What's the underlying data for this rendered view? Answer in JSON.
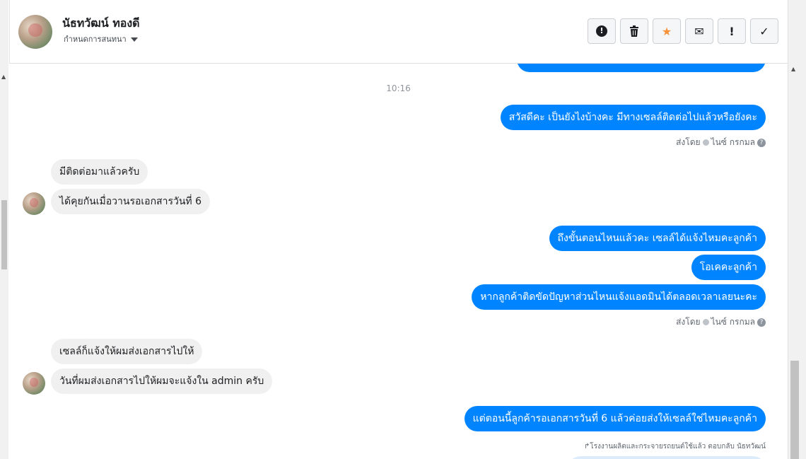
{
  "header": {
    "name": "นัธทวัฒน์ ทองดี",
    "subtitle": "กำหนดการสนทนา",
    "actions": [
      {
        "icon": "alert-circle-icon",
        "glyph": "!"
      },
      {
        "icon": "trash-icon",
        "glyph": "🗑"
      },
      {
        "icon": "star-icon",
        "glyph": "★"
      },
      {
        "icon": "envelope-icon",
        "glyph": "✉"
      },
      {
        "icon": "exclamation-icon",
        "glyph": "!"
      },
      {
        "icon": "checkmark-icon",
        "glyph": "✓"
      }
    ]
  },
  "conversation": {
    "timestamp": "10:16",
    "outgoing_1": "สวัสดีคะ เป็นยังไงบ้างคะ มีทางเซลล์ติดต่อไปแล้วหรือยังคะ",
    "sent_by_1": {
      "prefix": "ส่งโดย",
      "sender": "ไนซ์ กรกมล"
    },
    "incoming_1": "มีติดต่อมาแล้วครับ",
    "incoming_2": "ได้คุยกันเมื่อวานรอเอกสารวันที่ 6",
    "outgoing_2": "ถึงขั้นตอนไหนแล้วคะ เซลล์ได้แจ้งไหมคะลูกค้า",
    "outgoing_3": "โอเคคะลูกค้า",
    "outgoing_4": "หากลูกค้าติดขัดปัญหาส่วนไหนแจ้งแอดมินได้ตลอดเวลาเลยนะคะ",
    "sent_by_2": {
      "prefix": "ส่งโดย",
      "sender": "ไนซ์ กรกมล"
    },
    "incoming_3": "เซลล์ก็แจ้งให้ผมส่งเอกสารไปให้",
    "incoming_4": "วันที่ผมส่งเอกสารไปให้ผมจะแจ้งใน admin ครับ",
    "outgoing_5": "แต่ตอนนี้ลูกค้ารอเอกสารวันที่ 6 แล้วค่อยส่งให้เซลล์ใช่ไหมคะลูกค้า",
    "reply_note": "โรงงานผลิตและกระจายรถยนต์ใช้แล้ว ตอบกลับ นัธทวัฒน์"
  },
  "colors": {
    "outgoing": "#0084ff",
    "incoming": "#f1f0f0",
    "star": "#f7923a"
  }
}
